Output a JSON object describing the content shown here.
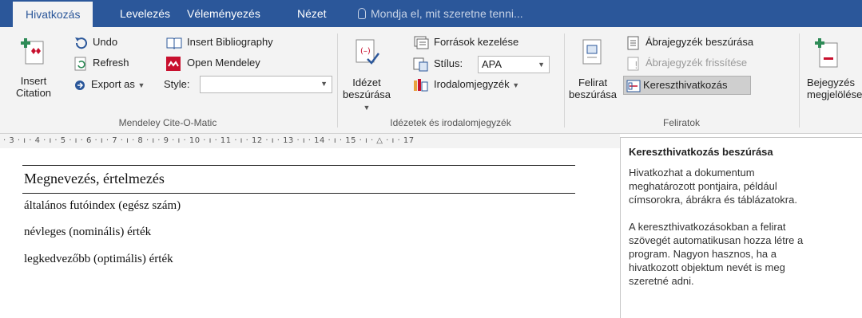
{
  "tabs": [
    "Hivatkozás",
    "Levelezés",
    "Véleményezés",
    "Nézet"
  ],
  "tell_me": "Mondja el, mit szeretne tenni...",
  "mendeley": {
    "insert_citation": [
      "Insert",
      "Citation"
    ],
    "undo": "Undo",
    "refresh": "Refresh",
    "export_as": "Export as",
    "insert_bibliography": "Insert Bibliography",
    "open_mendeley": "Open Mendeley",
    "style_label": "Style:",
    "style_value": "",
    "group_label": "Mendeley Cite-O-Matic"
  },
  "citations": {
    "insert_citation": [
      "Idézet",
      "beszúrása"
    ],
    "manage_sources": "Források kezelése",
    "style_label": "Stílus:",
    "style_value": "APA",
    "bibliography": "Irodalomjegyzék",
    "group_label": "Idézetek és irodalomjegyzék"
  },
  "captions": {
    "insert_caption": [
      "Felirat",
      "beszúrása"
    ],
    "insert_table_of_figures": "Ábrajegyzék beszúrása",
    "update_table": "Ábrajegyzék frissítése",
    "cross_reference": "Kereszthivatkozás",
    "group_label": "Feliratok"
  },
  "index": {
    "mark_entry": [
      "Bejegyzés",
      "megjelölése"
    ]
  },
  "ruler_text": "· 3 · ı · 4 · ı · 5 · ı · 6 · ı · 7 · ı · 8 · ı · 9 · ı · 10 · ı · 11 · ı · 12 · ı · 13 · ı · 14 · ı · 15 · ı · △ · ı · 17",
  "document": {
    "header": "Megnevezés, értelmezés",
    "rows": [
      "általános futóindex (egész szám)",
      "névleges (nominális) érték",
      "legkedvezőbb (optimális) érték"
    ]
  },
  "tooltip": {
    "title": "Kereszthivatkozás beszúrása",
    "para1": [
      "Hivatkozhat a dokumentum",
      "meghatározott pontjaira, például",
      "címsorokra, ábrákra és táblázatokra."
    ],
    "para2": [
      "A kereszthivatkozásokban a felirat",
      "szövegét automatikusan hozza létre a",
      "program. Nagyon hasznos, ha a",
      "hivatkozott objektum nevét is meg",
      "szeretné adni."
    ]
  },
  "colors": {
    "accent": "#2b579a",
    "mendeley_red": "#c8102e",
    "ribbon_bg": "#f3f3f3"
  }
}
